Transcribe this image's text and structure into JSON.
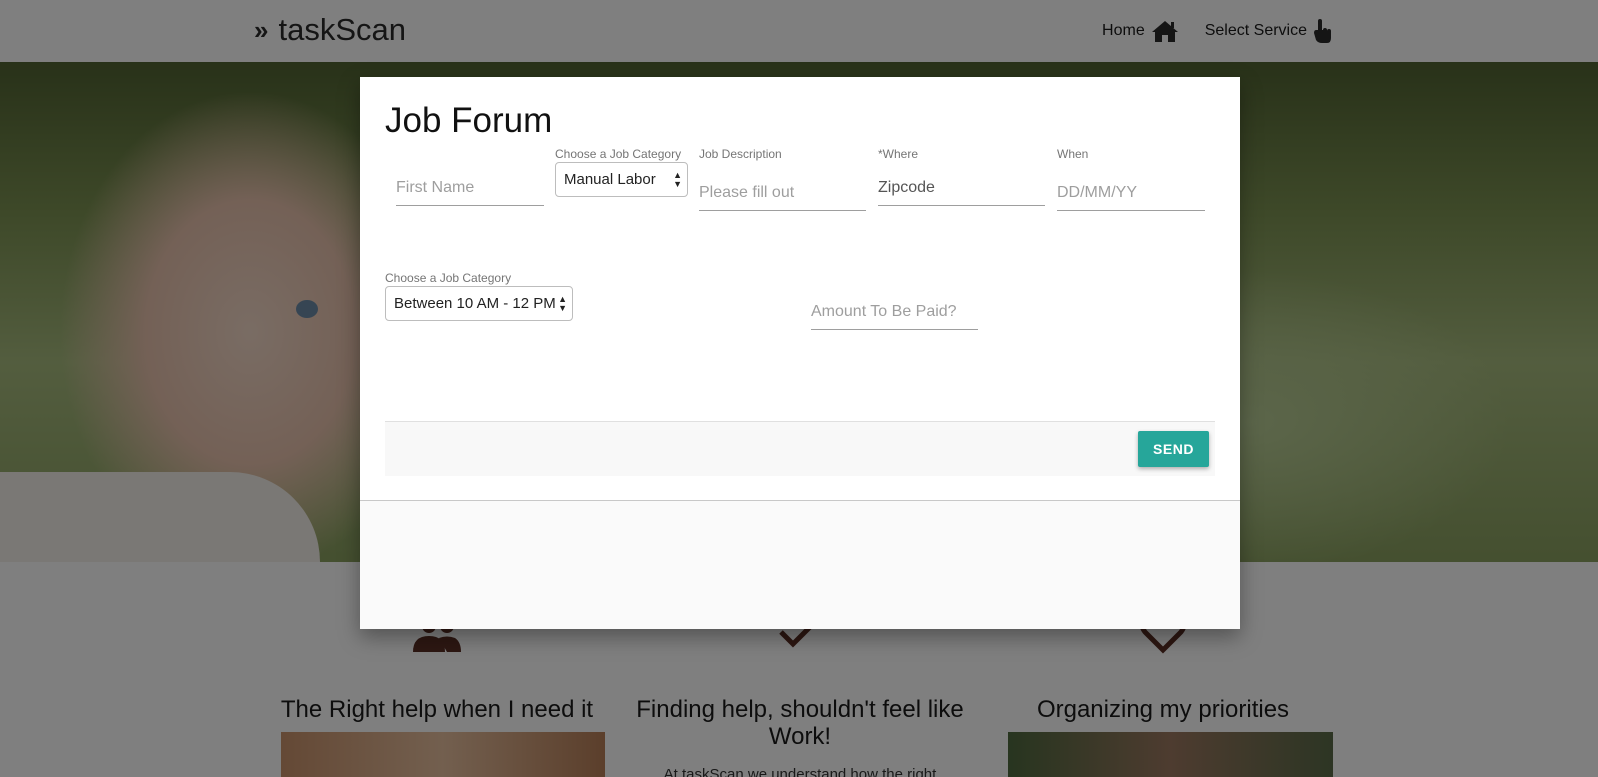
{
  "navbar": {
    "brand_icon": "»",
    "brand_name": "taskScan",
    "links": [
      {
        "label": "Home",
        "icon": "home-icon"
      },
      {
        "label": "Select Service",
        "icon": "pointing-hand-icon"
      }
    ]
  },
  "features": [
    {
      "icon": "people-icon",
      "title": "The Right help when I need it",
      "text": ""
    },
    {
      "icon": "check-icon",
      "title": "Finding help, shouldn't feel like Work!",
      "text": "At taskScan we understand how the right"
    },
    {
      "icon": "heart-icon",
      "title": "Organizing my priorities",
      "text": ""
    }
  ],
  "modal": {
    "title": "Job Forum",
    "first_name": {
      "placeholder": "First Name"
    },
    "job_category": {
      "label": "Choose a Job Category",
      "selected": "Manual Labor"
    },
    "job_description": {
      "label": "Job Description",
      "placeholder": "Please fill out"
    },
    "where": {
      "label": "*Where",
      "value": "Zipcode"
    },
    "when": {
      "label": "When",
      "placeholder": "DD/MM/YY"
    },
    "time_category": {
      "label": "Choose a Job Category",
      "selected": "Between 10 AM - 12 PM"
    },
    "amount": {
      "placeholder": "Amount To Be Paid?"
    },
    "send_label": "SEND"
  },
  "colors": {
    "accent": "#26a69a",
    "feature_icon": "#5b2e24"
  }
}
